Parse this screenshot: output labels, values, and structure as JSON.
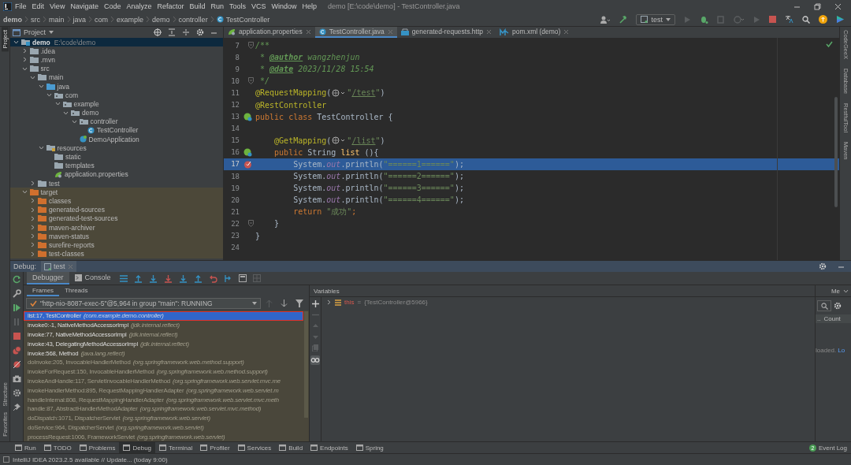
{
  "window": {
    "title": "demo [E:\\code\\demo] - TestController.java",
    "menu": [
      "File",
      "Edit",
      "View",
      "Navigate",
      "Code",
      "Analyze",
      "Refactor",
      "Build",
      "Run",
      "Tools",
      "VCS",
      "Window",
      "Help"
    ]
  },
  "breadcrumbs": [
    "demo",
    "src",
    "main",
    "java",
    "com",
    "example",
    "demo",
    "controller",
    "TestController"
  ],
  "run_config": {
    "label": "test"
  },
  "left_tool_tabs": {
    "top": [
      {
        "label": "Project",
        "selected": true
      }
    ],
    "bottom": [
      {
        "label": "Structure",
        "selected": false
      },
      {
        "label": "Favorites",
        "selected": false
      }
    ]
  },
  "right_tool_tabs": [
    "CodeGeeX",
    "Database",
    "RestfulTool",
    "Maven"
  ],
  "project_panel": {
    "title": "Project",
    "tree": [
      {
        "label": "demo",
        "path": "E:\\code\\demo",
        "kind": "module",
        "expanded": true,
        "selected": true,
        "children": [
          {
            "label": ".idea",
            "kind": "folder",
            "expanded": false,
            "selected": false
          },
          {
            "label": ".mvn",
            "kind": "folder",
            "expanded": false,
            "selected": false
          },
          {
            "label": "src",
            "kind": "folder",
            "expanded": true,
            "selected": false,
            "children": [
              {
                "label": "main",
                "kind": "folder",
                "expanded": true,
                "selected": false,
                "children": [
                  {
                    "label": "java",
                    "kind": "source",
                    "expanded": true,
                    "selected": false,
                    "children": [
                      {
                        "label": "com",
                        "kind": "package",
                        "expanded": true,
                        "selected": false,
                        "children": [
                          {
                            "label": "example",
                            "kind": "package",
                            "expanded": true,
                            "selected": false,
                            "children": [
                              {
                                "label": "demo",
                                "kind": "package",
                                "expanded": true,
                                "selected": false,
                                "children": [
                                  {
                                    "label": "controller",
                                    "kind": "package",
                                    "expanded": true,
                                    "selected": false,
                                    "children": [
                                      {
                                        "label": "TestController",
                                        "kind": "class",
                                        "selected": false
                                      }
                                    ]
                                  },
                                  {
                                    "label": "DemoApplication",
                                    "kind": "spring-class",
                                    "selected": false
                                  }
                                ]
                              }
                            ]
                          }
                        ]
                      }
                    ]
                  },
                  {
                    "label": "resources",
                    "kind": "resources",
                    "expanded": true,
                    "selected": false,
                    "children": [
                      {
                        "label": "static",
                        "kind": "plain-folder",
                        "selected": false
                      },
                      {
                        "label": "templates",
                        "kind": "plain-folder",
                        "selected": false
                      },
                      {
                        "label": "application.properties",
                        "kind": "properties",
                        "selected": false
                      }
                    ]
                  }
                ]
              },
              {
                "label": "test",
                "kind": "folder",
                "expanded": false,
                "selected": false
              }
            ]
          },
          {
            "label": "target",
            "kind": "excluded",
            "expanded": true,
            "selected": false,
            "children": [
              {
                "label": "classes",
                "kind": "excluded",
                "expanded": false,
                "selected": false
              },
              {
                "label": "generated-sources",
                "kind": "excluded",
                "expanded": false,
                "selected": false
              },
              {
                "label": "generated-test-sources",
                "kind": "excluded",
                "expanded": false,
                "selected": false
              },
              {
                "label": "maven-archiver",
                "kind": "excluded",
                "expanded": false,
                "selected": false
              },
              {
                "label": "maven-status",
                "kind": "excluded",
                "expanded": false,
                "selected": false
              },
              {
                "label": "surefire-reports",
                "kind": "excluded",
                "expanded": false,
                "selected": false
              },
              {
                "label": "test-classes",
                "kind": "excluded",
                "expanded": false,
                "selected": false
              }
            ]
          }
        ]
      }
    ]
  },
  "editor": {
    "tabs": [
      {
        "label": "application.properties",
        "kind": "properties",
        "selected": false
      },
      {
        "label": "TestController.java",
        "kind": "class",
        "selected": true
      },
      {
        "label": "generated-requests.http",
        "kind": "http",
        "selected": false
      },
      {
        "label": "pom.xml (demo)",
        "kind": "maven",
        "selected": false
      }
    ],
    "lines": [
      {
        "number": "7",
        "gutter": {
          "kind": "fold"
        },
        "selected": false,
        "tokens": [
          {
            "kind": "comment",
            "text": "/**"
          }
        ]
      },
      {
        "number": "8",
        "selected": false,
        "tokens": [
          {
            "kind": "comment",
            "text": " * "
          },
          {
            "kind": "doctag",
            "text": "@author"
          },
          {
            "kind": "comment",
            "text": " wangzhenjun"
          }
        ]
      },
      {
        "number": "9",
        "selected": false,
        "tokens": [
          {
            "kind": "comment",
            "text": " * "
          },
          {
            "kind": "doctag",
            "text": "@date"
          },
          {
            "kind": "comment",
            "text": " 2023/11/28 15:54"
          }
        ]
      },
      {
        "number": "10",
        "gutter": {
          "kind": "fold"
        },
        "selected": false,
        "tokens": [
          {
            "kind": "comment",
            "text": " */"
          }
        ]
      },
      {
        "number": "11",
        "selected": false,
        "tokens": [
          {
            "kind": "annotation",
            "text": "@RequestMapping"
          },
          {
            "kind": "plain",
            "text": "("
          },
          {
            "kind": "globe"
          },
          {
            "kind": "string",
            "text": "\""
          },
          {
            "kind": "link",
            "text": "/test"
          },
          {
            "kind": "string",
            "text": "\""
          },
          {
            "kind": "plain",
            "text": ")"
          }
        ]
      },
      {
        "number": "12",
        "selected": false,
        "tokens": [
          {
            "kind": "annotation",
            "text": "@RestController"
          }
        ]
      },
      {
        "number": "13",
        "gutter": {
          "kind": "bean"
        },
        "selected": false,
        "tokens": [
          {
            "kind": "keyword",
            "text": "public class "
          },
          {
            "kind": "plain",
            "text": "TestController {"
          }
        ]
      },
      {
        "number": "14",
        "selected": false
      },
      {
        "number": "15",
        "selected": false,
        "tokens": [
          {
            "kind": "annotation",
            "text": "    @GetMapping"
          },
          {
            "kind": "plain",
            "text": "("
          },
          {
            "kind": "globe"
          },
          {
            "kind": "string",
            "text": "\""
          },
          {
            "kind": "link",
            "text": "/list"
          },
          {
            "kind": "string",
            "text": "\""
          },
          {
            "kind": "plain",
            "text": ")"
          }
        ]
      },
      {
        "number": "16",
        "gutter": {
          "kind": "bean"
        },
        "selected": false,
        "tokens": [
          {
            "kind": "keyword",
            "text": "    public "
          },
          {
            "kind": "plain",
            "text": "String "
          },
          {
            "kind": "method",
            "text": "list"
          },
          {
            "kind": "plain",
            "text": " (){"
          }
        ]
      },
      {
        "number": "17",
        "gutter": {
          "kind": "breakpoint"
        },
        "selected": true,
        "tokens": [
          {
            "kind": "plain",
            "text": "        System."
          },
          {
            "kind": "field",
            "text": "out"
          },
          {
            "kind": "plain",
            "text": ".println("
          },
          {
            "kind": "string",
            "text": "\"======1======\""
          },
          {
            "kind": "plain",
            "text": ");"
          }
        ]
      },
      {
        "number": "18",
        "selected": false,
        "tokens": [
          {
            "kind": "plain",
            "text": "        System."
          },
          {
            "kind": "field",
            "text": "out"
          },
          {
            "kind": "plain",
            "text": ".println("
          },
          {
            "kind": "string",
            "text": "\"======2======\""
          },
          {
            "kind": "plain",
            "text": ");"
          }
        ]
      },
      {
        "number": "19",
        "selected": false,
        "tokens": [
          {
            "kind": "plain",
            "text": "        System."
          },
          {
            "kind": "field",
            "text": "out"
          },
          {
            "kind": "plain",
            "text": ".println("
          },
          {
            "kind": "string",
            "text": "\"======3======\""
          },
          {
            "kind": "plain",
            "text": ");"
          }
        ]
      },
      {
        "number": "20",
        "selected": false,
        "tokens": [
          {
            "kind": "plain",
            "text": "        System."
          },
          {
            "kind": "field",
            "text": "out"
          },
          {
            "kind": "plain",
            "text": ".println("
          },
          {
            "kind": "string",
            "text": "\"======4======\""
          },
          {
            "kind": "plain",
            "text": ");"
          }
        ]
      },
      {
        "number": "21",
        "selected": false,
        "tokens": [
          {
            "kind": "keyword",
            "text": "        return "
          },
          {
            "kind": "string",
            "text": "\"成功\""
          },
          {
            "kind": "keyword",
            "text": ";"
          }
        ]
      },
      {
        "number": "22",
        "gutter": {
          "kind": "fold"
        },
        "selected": false,
        "tokens": [
          {
            "kind": "plain",
            "text": "    }"
          }
        ]
      },
      {
        "number": "23",
        "selected": false,
        "tokens": [
          {
            "kind": "plain",
            "text": "}"
          }
        ]
      },
      {
        "number": "24",
        "selected": false
      }
    ]
  },
  "debug": {
    "label": "Debug:",
    "session_tab": "test",
    "view_tabs": [
      {
        "label": "Debugger",
        "selected": true
      },
      {
        "label": "Console",
        "selected": false
      }
    ],
    "frame_tabs": [
      {
        "label": "Frames",
        "selected": true
      },
      {
        "label": "Threads",
        "selected": false
      }
    ],
    "thread": "\"http-nio-8087-exec-5\"@5,964 in group \"main\": RUNNING",
    "frames": [
      {
        "location": "list:17, TestController",
        "package": "(com.example.demo.controller)",
        "selected": true,
        "dimmed": false,
        "outlined": true
      },
      {
        "location": "invoke0:-1, NativeMethodAccessorImpl",
        "package": "(jdk.internal.reflect)",
        "selected": false,
        "dimmed": false,
        "outlined": false
      },
      {
        "location": "invoke:77, NativeMethodAccessorImpl",
        "package": "(jdk.internal.reflect)",
        "selected": false,
        "dimmed": false,
        "outlined": false
      },
      {
        "location": "invoke:43, DelegatingMethodAccessorImpl",
        "package": "(jdk.internal.reflect)",
        "selected": false,
        "dimmed": false,
        "outlined": false
      },
      {
        "location": "invoke:568, Method",
        "package": "(java.lang.reflect)",
        "selected": false,
        "dimmed": false,
        "outlined": false
      },
      {
        "location": "doInvoke:205, InvocableHandlerMethod",
        "package": "(org.springframework.web.method.support)",
        "selected": false,
        "dimmed": true,
        "outlined": false
      },
      {
        "location": "invokeForRequest:150, InvocableHandlerMethod",
        "package": "(org.springframework.web.method.support)",
        "selected": false,
        "dimmed": true,
        "outlined": false
      },
      {
        "location": "invokeAndHandle:117, ServletInvocableHandlerMethod",
        "package": "(org.springframework.web.servlet.mvc.me",
        "selected": false,
        "dimmed": true,
        "outlined": false
      },
      {
        "location": "invokeHandlerMethod:895, RequestMappingHandlerAdapter",
        "package": "(org.springframework.web.servlet.m",
        "selected": false,
        "dimmed": true,
        "outlined": false
      },
      {
        "location": "handleInternal:808, RequestMappingHandlerAdapter",
        "package": "(org.springframework.web.servlet.mvc.meth",
        "selected": false,
        "dimmed": true,
        "outlined": false
      },
      {
        "location": "handle:87, AbstractHandlerMethodAdapter",
        "package": "(org.springframework.web.servlet.mvc.method)",
        "selected": false,
        "dimmed": true,
        "outlined": false
      },
      {
        "location": "doDispatch:1071, DispatcherServlet",
        "package": "(org.springframework.web.servlet)",
        "selected": false,
        "dimmed": true,
        "outlined": false
      },
      {
        "location": "doService:964, DispatcherServlet",
        "package": "(org.springframework.web.servlet)",
        "selected": false,
        "dimmed": true,
        "outlined": false
      },
      {
        "location": "processRequest:1006, FrameworkServlet",
        "package": "(org.springframework.web.servlet)",
        "selected": false,
        "dimmed": true,
        "outlined": false
      }
    ],
    "variables": {
      "title": "Variables",
      "items": [
        {
          "name": "this",
          "operator": "=",
          "value": "{TestController@5966}",
          "expanded": false
        }
      ]
    },
    "memory": {
      "tab": "Me",
      "column_1": "..",
      "column_2": "Count",
      "message": "loaded.",
      "link": "Lo"
    }
  },
  "tool_windows": [
    {
      "label": "Run",
      "selected": false
    },
    {
      "label": "TODO",
      "selected": false
    },
    {
      "label": "Problems",
      "selected": false
    },
    {
      "label": "Debug",
      "selected": true
    },
    {
      "label": "Terminal",
      "selected": false
    },
    {
      "label": "Profiler",
      "selected": false
    },
    {
      "label": "Services",
      "selected": false
    },
    {
      "label": "Build",
      "selected": false
    },
    {
      "label": "Endpoints",
      "selected": false
    },
    {
      "label": "Spring",
      "selected": false
    }
  ],
  "event_log": {
    "label": "Event Log",
    "count": "2"
  },
  "status_bar": {
    "message": "IntelliJ IDEA 2023.2.5 available // Update... (today 9:00)"
  }
}
